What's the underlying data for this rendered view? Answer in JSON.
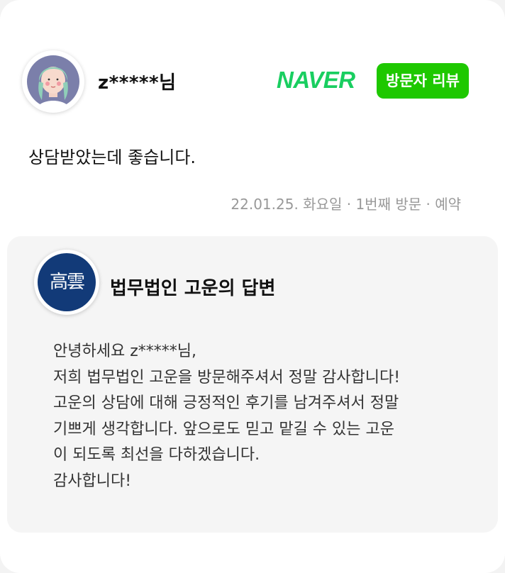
{
  "review": {
    "username": "z*****님",
    "naver_logo": "NAVER",
    "badge": "방문자 리뷰",
    "text": "상담받았는데 좋습니다.",
    "meta": "22.01.25. 화요일 · 1번째 방문 · 예약"
  },
  "reply": {
    "logo_text": "高雲",
    "title": "법무법인 고운의 답변",
    "lines": [
      "안녕하세요 z*****님,",
      "저희 법무법인 고운을 방문해주셔서 정말 감사합니다!",
      "고운의 상담에 대해 긍정적인 후기를 남겨주셔서 정말",
      "기쁘게 생각합니다. 앞으로도 믿고 맡길 수 있는 고운",
      "이 되도록 최선을 다하겠습니다.",
      "감사합니다!"
    ]
  },
  "colors": {
    "naver_green": "#19ce60",
    "badge_green": "#1ec800",
    "logo_navy": "#123a78",
    "meta_gray": "#999999"
  },
  "icons": {
    "avatar": "user-avatar-illustration",
    "owner_logo": "law-firm-logo"
  }
}
